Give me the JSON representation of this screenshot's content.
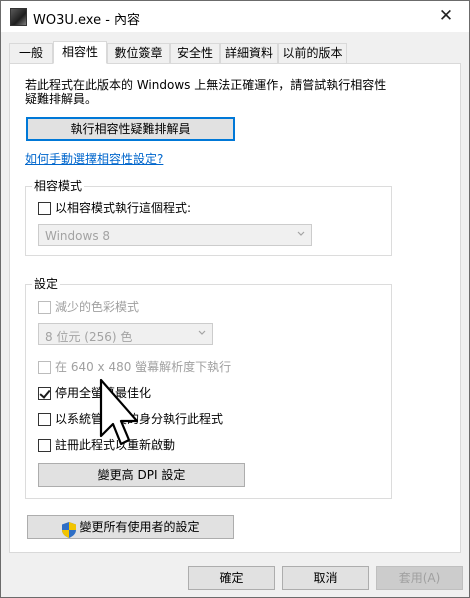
{
  "window": {
    "title": "WO3U.exe - 內容"
  },
  "tabs": [
    {
      "label": "一般"
    },
    {
      "label": "相容性"
    },
    {
      "label": "數位簽章"
    },
    {
      "label": "安全性"
    },
    {
      "label": "詳細資料"
    },
    {
      "label": "以前的版本"
    }
  ],
  "active_tab": "相容性",
  "compat": {
    "intro_line1": "若此程式在此版本的 Windows 上無法正確運作，請嘗試執行相容性",
    "intro_line2": "疑難排解員。",
    "run_troubleshooter": "執行相容性疑難排解員",
    "manual_link": "如何手動選擇相容性設定?",
    "mode_group": {
      "title": "相容模式",
      "checkbox_label": "以相容模式執行這個程式:",
      "checked": false,
      "os_select": "Windows 8"
    },
    "settings_group": {
      "title": "設定",
      "reduced_color_label": "減少的色彩模式",
      "color_select": "8 位元 (256) 色",
      "res640_label": "在 640 x 480 螢幕解析度下執行",
      "fullscreen_opt_label": "停用全螢幕最佳化",
      "fullscreen_opt_checked": true,
      "admin_label": "以系統管理員的身分執行此程式",
      "restart_label": "註冊此程式以重新啟動",
      "dpi_button": "變更高 DPI 設定"
    },
    "all_users_button": "變更所有使用者的設定"
  },
  "footer": {
    "ok": "確定",
    "cancel": "取消",
    "apply": "套用(A)"
  },
  "colors": {
    "accent": "#0078d7",
    "link": "#0066cc",
    "disabled": "#a0a0a0"
  }
}
